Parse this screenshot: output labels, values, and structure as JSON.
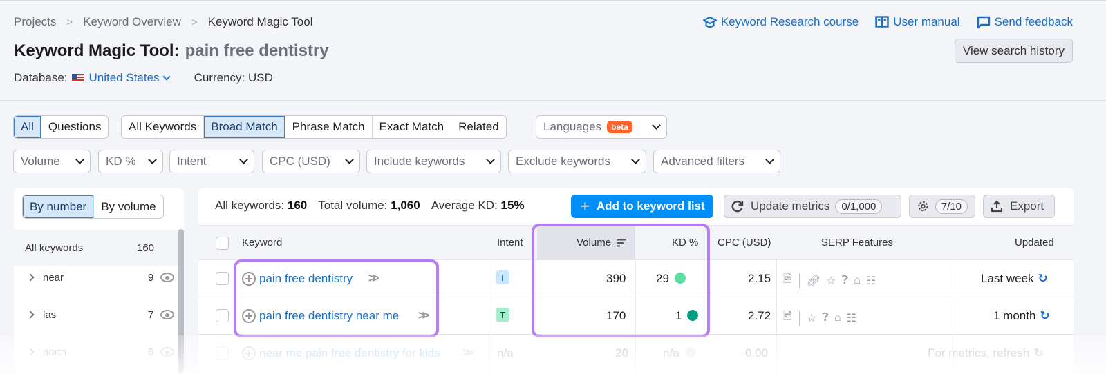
{
  "breadcrumb": [
    "Projects",
    "Keyword Overview",
    "Keyword Magic Tool"
  ],
  "toplinks": {
    "course": "Keyword Research course",
    "manual": "User manual",
    "feedback": "Send feedback"
  },
  "title": {
    "tool": "Keyword Magic Tool:",
    "query": "pain free dentistry"
  },
  "database": {
    "label": "Database:",
    "value": "United States",
    "currency": "Currency: USD"
  },
  "history_button": "View search history",
  "tabs_group1": [
    "All",
    "Questions"
  ],
  "tabs_group2": [
    "All Keywords",
    "Broad Match",
    "Phrase Match",
    "Exact Match",
    "Related"
  ],
  "languages": {
    "label": "Languages",
    "badge": "beta"
  },
  "filters": [
    "Volume",
    "KD %",
    "Intent",
    "CPC (USD)",
    "Include keywords",
    "Exclude keywords",
    "Advanced filters"
  ],
  "sidebar": {
    "toggle": [
      "By number",
      "By volume"
    ],
    "all": {
      "label": "All keywords",
      "count": "160"
    },
    "groups": [
      {
        "label": "near",
        "count": "9"
      },
      {
        "label": "las",
        "count": "7"
      },
      {
        "label": "north",
        "count": "6"
      }
    ]
  },
  "summary": {
    "all_label": "All keywords:",
    "all_value": "160",
    "volume_label": "Total volume:",
    "volume_value": "1,060",
    "kd_label": "Average KD:",
    "kd_value": "15%"
  },
  "actions": {
    "add": "Add to keyword list",
    "update": "Update metrics",
    "update_count": "0/1,000",
    "settings_count": "7/10",
    "export": "Export"
  },
  "columns": [
    "Keyword",
    "Intent",
    "Volume",
    "KD %",
    "CPC (USD)",
    "SERP Features",
    "Updated"
  ],
  "rows": [
    {
      "keyword": "pain free dentistry",
      "intent": "I",
      "volume": "390",
      "kd": "29",
      "kd_color": "#5ce0a4",
      "cpc": "2.15",
      "updated": "Last week"
    },
    {
      "keyword": "pain free dentistry near me",
      "intent": "T",
      "volume": "170",
      "kd": "1",
      "kd_color": "#009f81",
      "cpc": "2.72",
      "updated": "1 month"
    },
    {
      "keyword": "near me pain free dentistry for kids",
      "intent": "n/a",
      "volume": "20",
      "kd": "n/a",
      "kd_color": "#d0d0d6",
      "cpc": "0.00",
      "updated": "For metrics, refresh"
    }
  ],
  "colors": {
    "accent": "#008ff8",
    "link": "#1a6ec5",
    "highlight": "#b57cf4",
    "intent_i": "#c9e7ff",
    "intent_t": "#a2efc9"
  }
}
